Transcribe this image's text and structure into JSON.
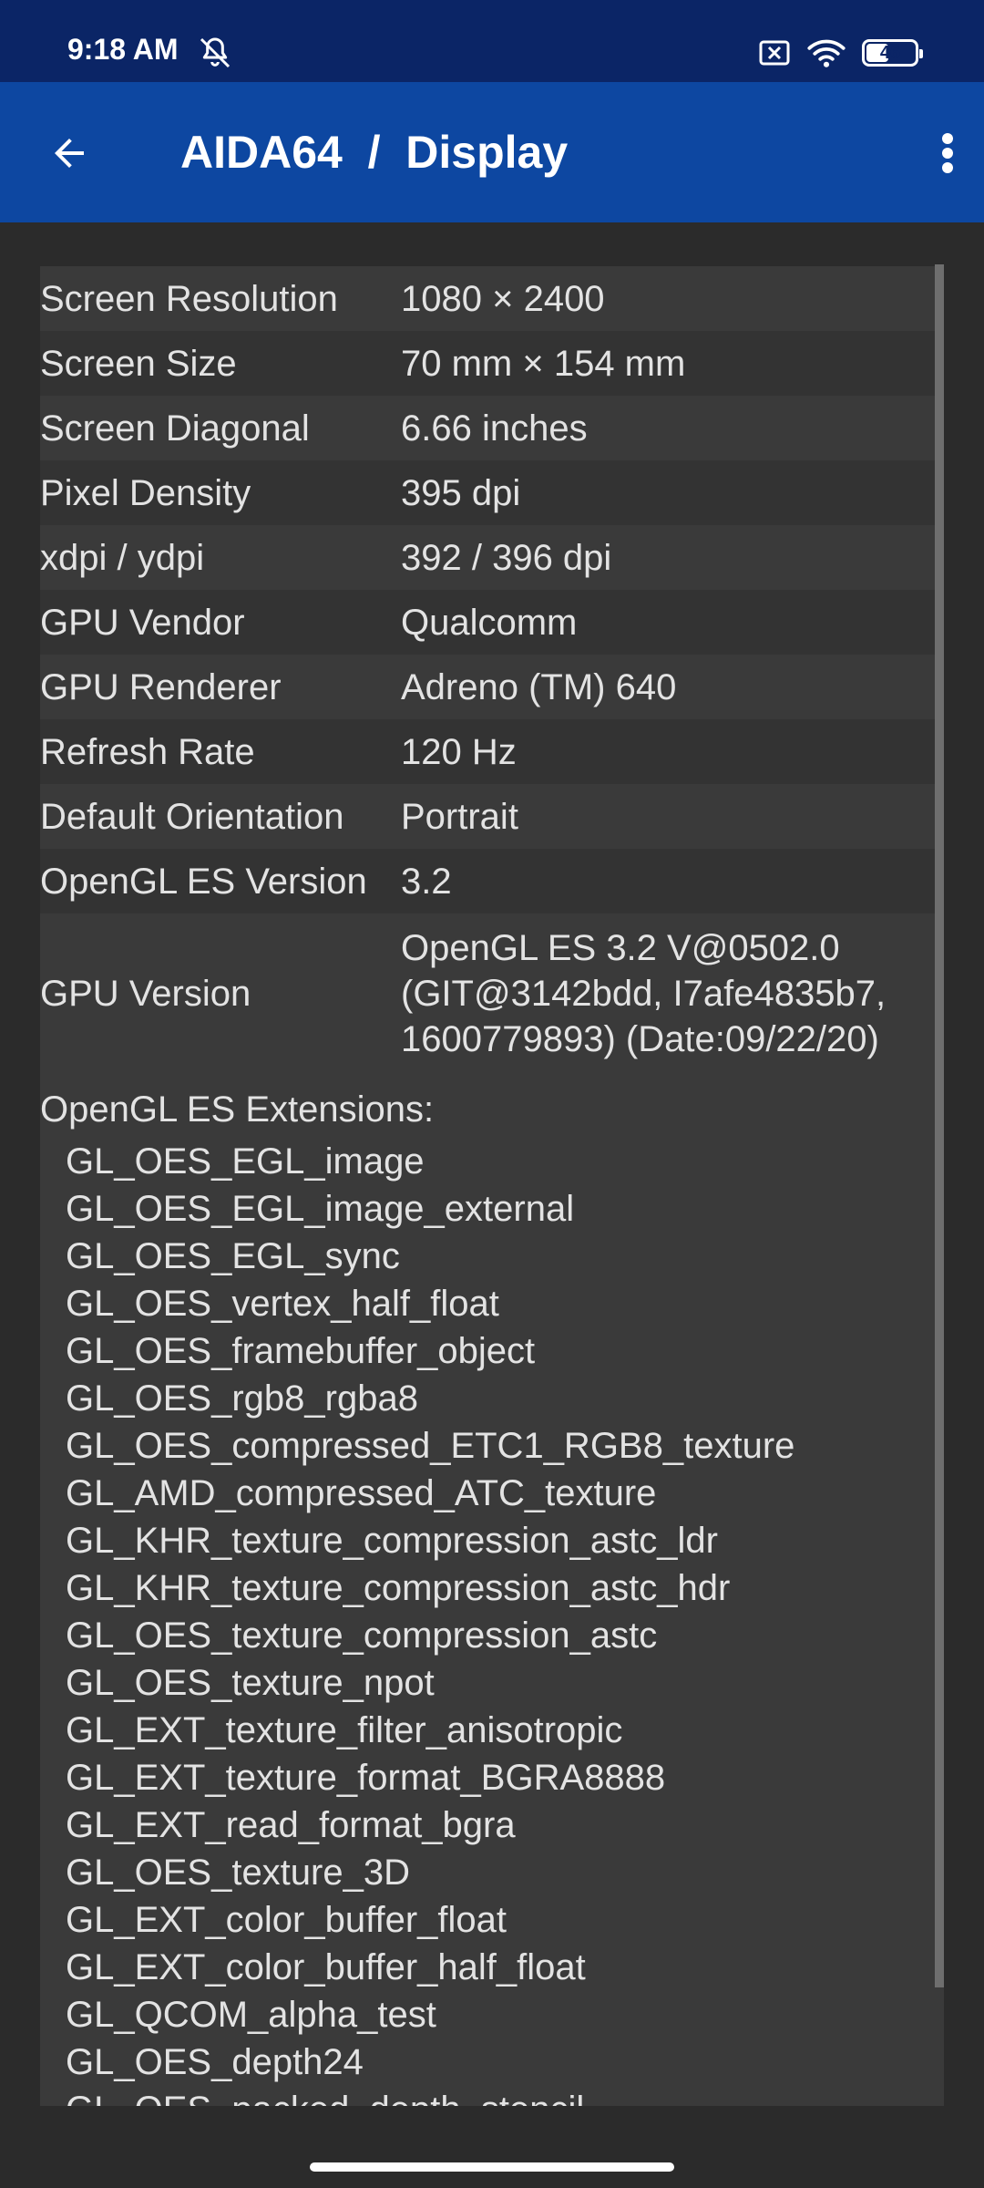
{
  "status_bar": {
    "time": "9:18 AM",
    "battery_level": "46",
    "battery_fraction": 0.46,
    "icons": [
      "mute-icon",
      "no-sim-icon",
      "wifi-icon",
      "battery-icon"
    ]
  },
  "app_bar": {
    "title": "AIDA64  /  Display",
    "back_icon": "back-arrow-icon",
    "menu_icon": "overflow-menu-icon"
  },
  "rows": [
    {
      "label": "Screen Resolution",
      "value": "1080 × 2400"
    },
    {
      "label": "Screen Size",
      "value": "70 mm × 154 mm"
    },
    {
      "label": "Screen Diagonal",
      "value": "6.66 inches"
    },
    {
      "label": "Pixel Density",
      "value": "395 dpi"
    },
    {
      "label": "xdpi / ydpi",
      "value": "392 / 396 dpi"
    },
    {
      "label": "GPU Vendor",
      "value": "Qualcomm"
    },
    {
      "label": "GPU Renderer",
      "value": "Adreno (TM) 640"
    },
    {
      "label": "Refresh Rate",
      "value": "120 Hz"
    },
    {
      "label": "Default Orientation",
      "value": "Portrait"
    },
    {
      "label": "OpenGL ES Version",
      "value": "3.2"
    }
  ],
  "gpu_version": {
    "label": "GPU Version",
    "value_lines": [
      "OpenGL ES 3.2 V@0502.0",
      "(GIT@3142bdd, I7afe4835b7,",
      "1600779893) (Date:09/22/20)"
    ]
  },
  "extensions": {
    "title": "OpenGL ES Extensions:",
    "items": [
      "GL_OES_EGL_image",
      "GL_OES_EGL_image_external",
      "GL_OES_EGL_sync",
      "GL_OES_vertex_half_float",
      "GL_OES_framebuffer_object",
      "GL_OES_rgb8_rgba8",
      "GL_OES_compressed_ETC1_RGB8_texture",
      "GL_AMD_compressed_ATC_texture",
      "GL_KHR_texture_compression_astc_ldr",
      "GL_KHR_texture_compression_astc_hdr",
      "GL_OES_texture_compression_astc",
      "GL_OES_texture_npot",
      "GL_EXT_texture_filter_anisotropic",
      "GL_EXT_texture_format_BGRA8888",
      "GL_EXT_read_format_bgra",
      "GL_OES_texture_3D",
      "GL_EXT_color_buffer_float",
      "GL_EXT_color_buffer_half_float",
      "GL_QCOM_alpha_test",
      "GL_OES_depth24",
      "GL_OES_packed_depth_stencil"
    ]
  },
  "colors": {
    "status_bar": "#0b2566",
    "app_bar": "#0d47a1",
    "background": "#2b2b2b",
    "row_light": "#3a3a3a",
    "row_dark": "#333333",
    "text": "#e3e3e3"
  }
}
